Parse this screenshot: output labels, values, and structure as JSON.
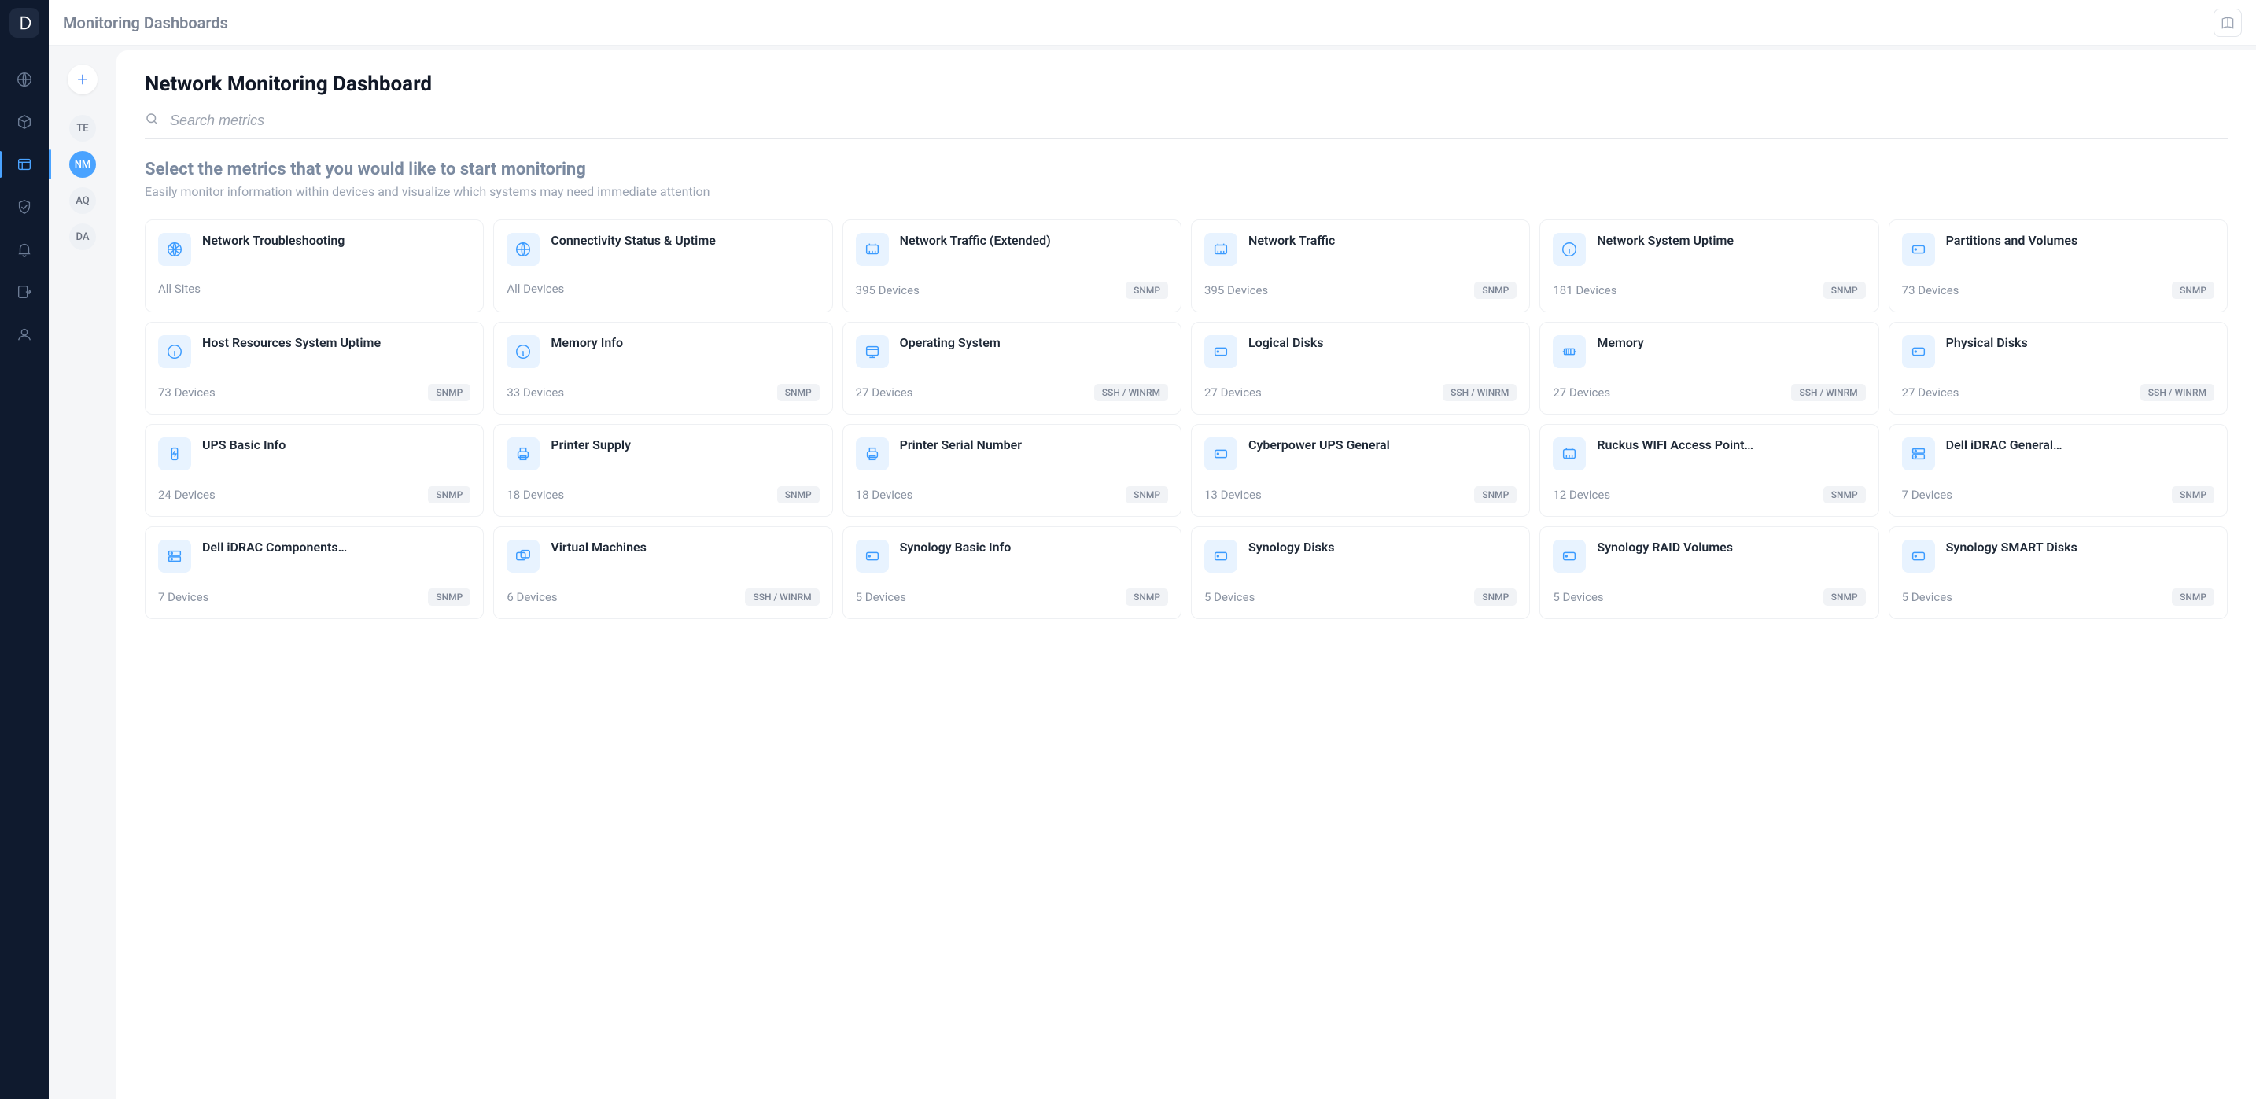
{
  "header": {
    "title": "Monitoring Dashboards"
  },
  "dashboard": {
    "title": "Network Monitoring Dashboard",
    "search_placeholder": "Search metrics",
    "section_heading": "Select the metrics that you would like to start monitoring",
    "section_subtext": "Easily monitor information within devices and visualize which systems may need immediate attention"
  },
  "sidebar": {
    "items": [
      {
        "label": "TE",
        "active": false
      },
      {
        "label": "NM",
        "active": true
      },
      {
        "label": "AQ",
        "active": false
      },
      {
        "label": "DA",
        "active": false
      }
    ]
  },
  "metrics": [
    {
      "title": "Network Troubleshooting",
      "count": "All Sites",
      "badge": "",
      "icon": "globe-net"
    },
    {
      "title": "Connectivity Status & Uptime",
      "count": "All Devices",
      "badge": "",
      "icon": "globe"
    },
    {
      "title": "Network Traffic (Extended)",
      "count": "395 Devices",
      "badge": "SNMP",
      "icon": "port"
    },
    {
      "title": "Network Traffic",
      "count": "395 Devices",
      "badge": "SNMP",
      "icon": "port"
    },
    {
      "title": "Network System Uptime",
      "count": "181 Devices",
      "badge": "SNMP",
      "icon": "info"
    },
    {
      "title": "Partitions and Volumes",
      "count": "73 Devices",
      "badge": "SNMP",
      "icon": "disk"
    },
    {
      "title": "Host Resources System Uptime",
      "count": "73 Devices",
      "badge": "SNMP",
      "icon": "info"
    },
    {
      "title": "Memory Info",
      "count": "33 Devices",
      "badge": "SNMP",
      "icon": "info"
    },
    {
      "title": "Operating System",
      "count": "27 Devices",
      "badge": "SSH / WINRM",
      "icon": "os"
    },
    {
      "title": "Logical Disks",
      "count": "27 Devices",
      "badge": "SSH / WINRM",
      "icon": "disk"
    },
    {
      "title": "Memory",
      "count": "27 Devices",
      "badge": "SSH / WINRM",
      "icon": "memory"
    },
    {
      "title": "Physical Disks",
      "count": "27 Devices",
      "badge": "SSH / WINRM",
      "icon": "disk"
    },
    {
      "title": "UPS Basic Info",
      "count": "24 Devices",
      "badge": "SNMP",
      "icon": "ups"
    },
    {
      "title": "Printer Supply",
      "count": "18 Devices",
      "badge": "SNMP",
      "icon": "printer"
    },
    {
      "title": "Printer Serial Number",
      "count": "18 Devices",
      "badge": "SNMP",
      "icon": "printer"
    },
    {
      "title": "Cyberpower UPS General",
      "count": "13 Devices",
      "badge": "SNMP",
      "icon": "disk"
    },
    {
      "title": "Ruckus WIFI Access Point…",
      "count": "12 Devices",
      "badge": "SNMP",
      "icon": "port"
    },
    {
      "title": "Dell iDRAC General…",
      "count": "7 Devices",
      "badge": "SNMP",
      "icon": "server"
    },
    {
      "title": "Dell iDRAC Components…",
      "count": "7 Devices",
      "badge": "SNMP",
      "icon": "server"
    },
    {
      "title": "Virtual Machines",
      "count": "6 Devices",
      "badge": "SSH / WINRM",
      "icon": "vm"
    },
    {
      "title": "Synology Basic Info",
      "count": "5 Devices",
      "badge": "SNMP",
      "icon": "disk"
    },
    {
      "title": "Synology Disks",
      "count": "5 Devices",
      "badge": "SNMP",
      "icon": "disk"
    },
    {
      "title": "Synology RAID Volumes",
      "count": "5 Devices",
      "badge": "SNMP",
      "icon": "disk"
    },
    {
      "title": "Synology SMART Disks",
      "count": "5 Devices",
      "badge": "SNMP",
      "icon": "disk"
    }
  ]
}
